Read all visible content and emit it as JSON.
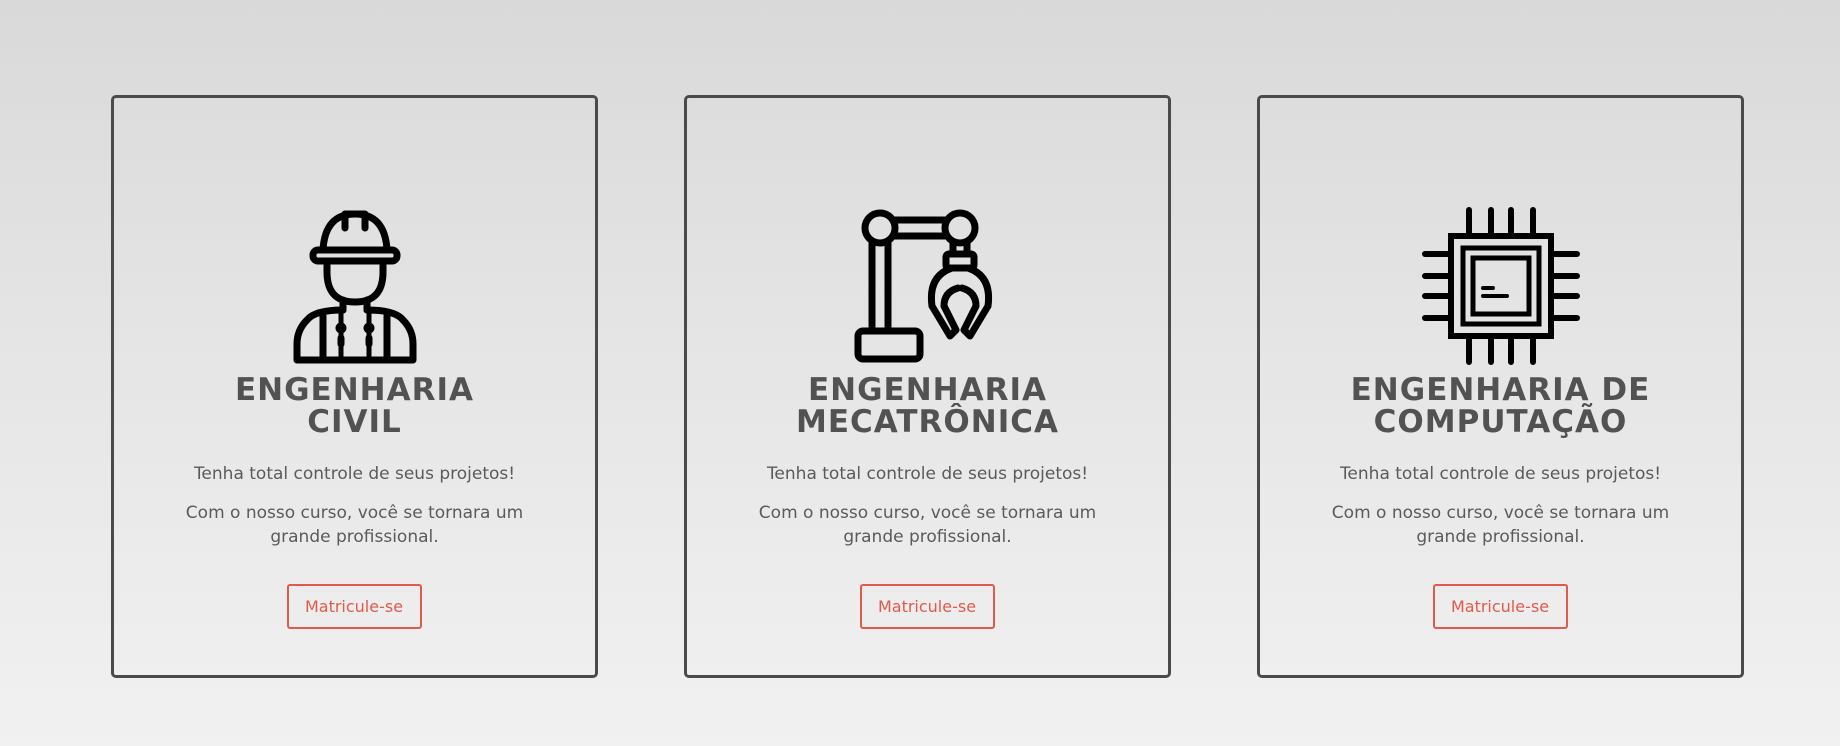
{
  "colors": {
    "card_border": "#4a4a4a",
    "title": "#525252",
    "text": "#5a5a5a",
    "accent": "#e05a4d",
    "icon": "#000000"
  },
  "cards": [
    {
      "icon": "construction-worker-icon",
      "title_line1": "ENGENHARIA",
      "title_line2": "CIVIL",
      "tagline": "Tenha total controle de seus projetos!",
      "description": "Com o nosso curso, você se tornara um grande profissional.",
      "button_label": "Matricule-se"
    },
    {
      "icon": "robotic-arm-icon",
      "title_line1": "ENGENHARIA",
      "title_line2": "MECATRÔNICA",
      "tagline": "Tenha total controle de seus projetos!",
      "description": "Com o nosso curso, você se tornara um grande profissional.",
      "button_label": "Matricule-se"
    },
    {
      "icon": "microchip-icon",
      "title_line1": "ENGENHARIA DE",
      "title_line2": "COMPUTAÇÃO",
      "tagline": "Tenha total controle de seus projetos!",
      "description": "Com o nosso curso, você se tornara um grande profissional.",
      "button_label": "Matricule-se"
    }
  ]
}
